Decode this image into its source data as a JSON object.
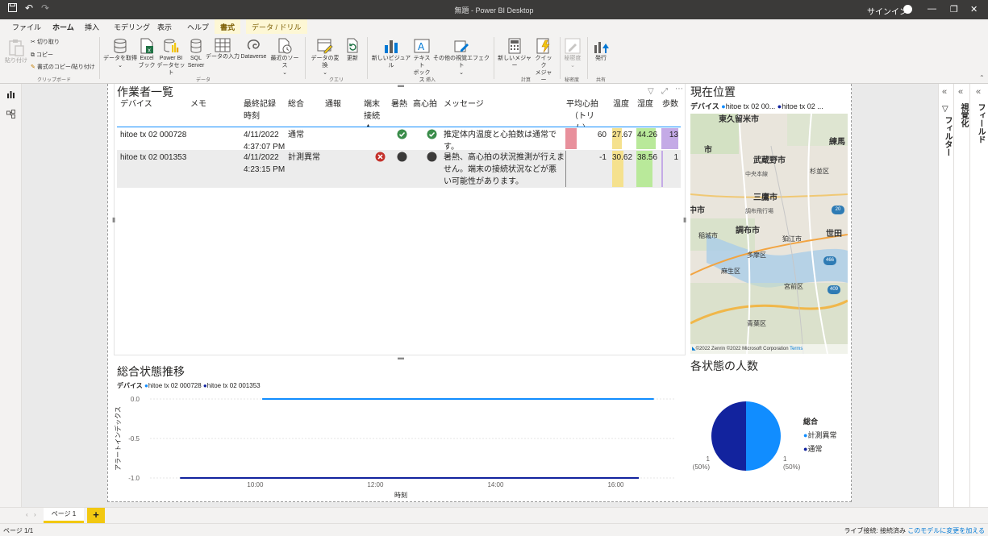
{
  "titlebar": {
    "title": "無題 - Power BI Desktop",
    "signin": "サインイン"
  },
  "menu": {
    "tabs": [
      "ファイル",
      "ホーム",
      "挿入",
      "モデリング",
      "表示",
      "ヘルプ",
      "書式",
      "データ / ドリル"
    ]
  },
  "ribbon": {
    "paste": "貼り付け",
    "cut": "切り取り",
    "copy": "コピー",
    "format_painter": "書式のコピー/貼り付け",
    "group_clipboard": "クリップボード",
    "get_data": "データを取得",
    "excel": "Excel",
    "excel2": "ブック",
    "pbi": "Power BI",
    "pbi2": "データセット",
    "sql": "SQL",
    "sql2": "Server",
    "enter_data": "データの入力",
    "dataverse": "Dataverse",
    "recent": "最近のソース",
    "group_data": "データ",
    "transform": "データの変換",
    "refresh": "更新",
    "group_query": "クエリ",
    "new_visual": "新しいビジュアル",
    "textbox": "テキスト",
    "textbox2": "ボックス",
    "more_visuals": "その他の視覚エフェクト",
    "group_insert": "挿入",
    "new_measure": "新しいメジャー",
    "quick_measure": "クイック",
    "quick_measure2": "メジャー",
    "group_calc": "計算",
    "sensitivity": "秘密度",
    "group_sensitivity": "秘密度",
    "publish": "発行",
    "group_share": "共有"
  },
  "table": {
    "title": "作業者一覧",
    "headers": {
      "device": "デバイス",
      "memo": "メモ",
      "last_time1": "最終記録",
      "last_time2": "時刻",
      "overall": "総合",
      "alert": "通報",
      "term1": "端末",
      "term2": "接続",
      "heat": "暑熱",
      "hr": "高心拍",
      "message": "メッセージ",
      "avg_hr1": "平均心拍",
      "avg_hr2": "（トリム）",
      "temp1": "温度",
      "temp2": "湿度",
      "steps": "歩数"
    },
    "rows": [
      {
        "device": "hitoe tx 02 000728",
        "date": "4/11/2022",
        "time": "4:37:07 PM",
        "overall": "通常",
        "msg1": "推定体内温度と心拍数は通常で",
        "msg2": "す。",
        "avg_hr": "60",
        "temp": "27.67",
        "humidity": "44.26",
        "steps": "13"
      },
      {
        "device": "hitoe tx 02 001353",
        "date": "4/11/2022",
        "time": "4:23:15 PM",
        "overall": "計測異常",
        "msg1": "暑熱、高心拍の状況推測が行えま",
        "msg2": "せん。端末の接続状況などが悪",
        "msg3": "い可能性があります。",
        "avg_hr": "-1",
        "temp": "30.62",
        "humidity": "38.56",
        "steps": "1"
      }
    ]
  },
  "map": {
    "title": "現在位置",
    "legend_label": "デバイス",
    "legend_items": [
      "hitoe tx 02 00...",
      "hitoe tx 02 ..."
    ],
    "places": [
      "東久留米市",
      "練馬",
      "市",
      "武蔵野市",
      "中央本線",
      "杉並区",
      "三鷹市",
      "中市",
      "調布飛行場",
      "調布市",
      "世田",
      "稲城市",
      "狛江市",
      "多摩区",
      "麻生区",
      "宮前区",
      "青葉区"
    ],
    "credit": "©2022 Zenrin ©2022 Microsoft Corporation",
    "terms": "Terms",
    "road_badges": [
      "20",
      "466",
      "409"
    ]
  },
  "line_chart": {
    "title": "総合状態推移",
    "legend_label": "デバイス",
    "xlabel": "時刻",
    "ylabel": "アラートインデックス"
  },
  "pie_chart": {
    "title": "各状態の人数",
    "legend_title": "総合",
    "left_label1": "1",
    "left_label2": "(50%)",
    "right_label1": "1",
    "right_label2": "(50%)"
  },
  "chart_data": [
    {
      "type": "line",
      "title": "総合状態推移",
      "xlabel": "時刻",
      "ylabel": "アラートインデックス",
      "x_ticks": [
        "10:00",
        "12:00",
        "14:00",
        "16:00"
      ],
      "y_ticks": [
        "0.0",
        "-0.5",
        "-1.0"
      ],
      "ylim": [
        -1.0,
        0.0
      ],
      "series": [
        {
          "name": "hitoe tx 02 000728",
          "color": "#118dff",
          "x": [
            "10:07",
            "16:38"
          ],
          "y": [
            0.0,
            0.0
          ]
        },
        {
          "name": "hitoe tx 02 001353",
          "color": "#12239e",
          "x": [
            "08:45",
            "16:23"
          ],
          "y": [
            -1.0,
            -1.0
          ]
        }
      ]
    },
    {
      "type": "pie",
      "title": "各状態の人数",
      "legend_title": "総合",
      "labels": [
        "計測異常",
        "通常"
      ],
      "values": [
        1,
        1
      ],
      "colors": [
        "#118dff",
        "#12239e"
      ]
    }
  ],
  "pages": {
    "tab1": "ページ 1",
    "add": "+"
  },
  "status": {
    "page_count": "ページ 1/1",
    "connection": "ライブ接続: 接続済み",
    "link": "このモデルに変更を加える"
  },
  "panes": {
    "filters": "フィルター",
    "viz": "視覚化",
    "fields": "フィールド"
  },
  "colors": {
    "pink": "#e8909c",
    "yellow": "#f5e18e",
    "green": "#b9e99a",
    "purple": "#c4aae6",
    "accent": "#f2c811"
  }
}
